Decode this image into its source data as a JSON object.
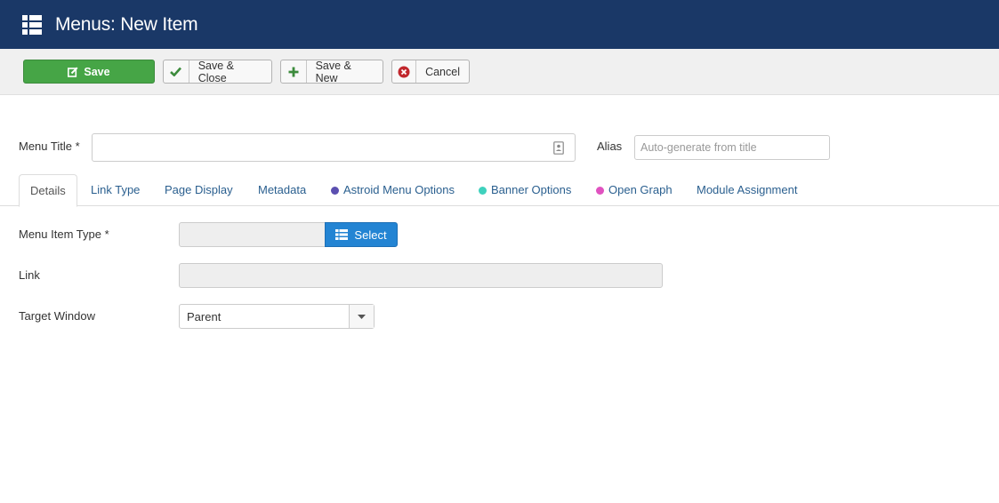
{
  "header": {
    "title": "Menus: New Item",
    "icon": "list-icon"
  },
  "toolbar": {
    "save_label": "Save",
    "save_close_label": "Save & Close",
    "save_new_label": "Save & New",
    "cancel_label": "Cancel"
  },
  "form": {
    "menu_title_label": "Menu Title *",
    "menu_title_value": "",
    "alias_label": "Alias",
    "alias_placeholder": "Auto-generate from title"
  },
  "tabs": [
    {
      "label": "Details",
      "active": true
    },
    {
      "label": "Link Type"
    },
    {
      "label": "Page Display"
    },
    {
      "label": "Metadata"
    },
    {
      "label": "Astroid Menu Options",
      "dot_color": "#5b4fb0"
    },
    {
      "label": "Banner Options",
      "dot_color": "#3fd1bd"
    },
    {
      "label": "Open Graph",
      "dot_color": "#e052c0"
    },
    {
      "label": "Module Assignment"
    }
  ],
  "details": {
    "menu_item_type_label": "Menu Item Type *",
    "menu_item_type_value": "",
    "select_label": "Select",
    "link_label": "Link",
    "link_value": "",
    "target_window_label": "Target Window",
    "target_window_value": "Parent"
  },
  "colors": {
    "header_bg": "#1a3867",
    "save_green": "#46a546",
    "select_blue": "#2384d3",
    "tab_link": "#2a5f8f"
  }
}
